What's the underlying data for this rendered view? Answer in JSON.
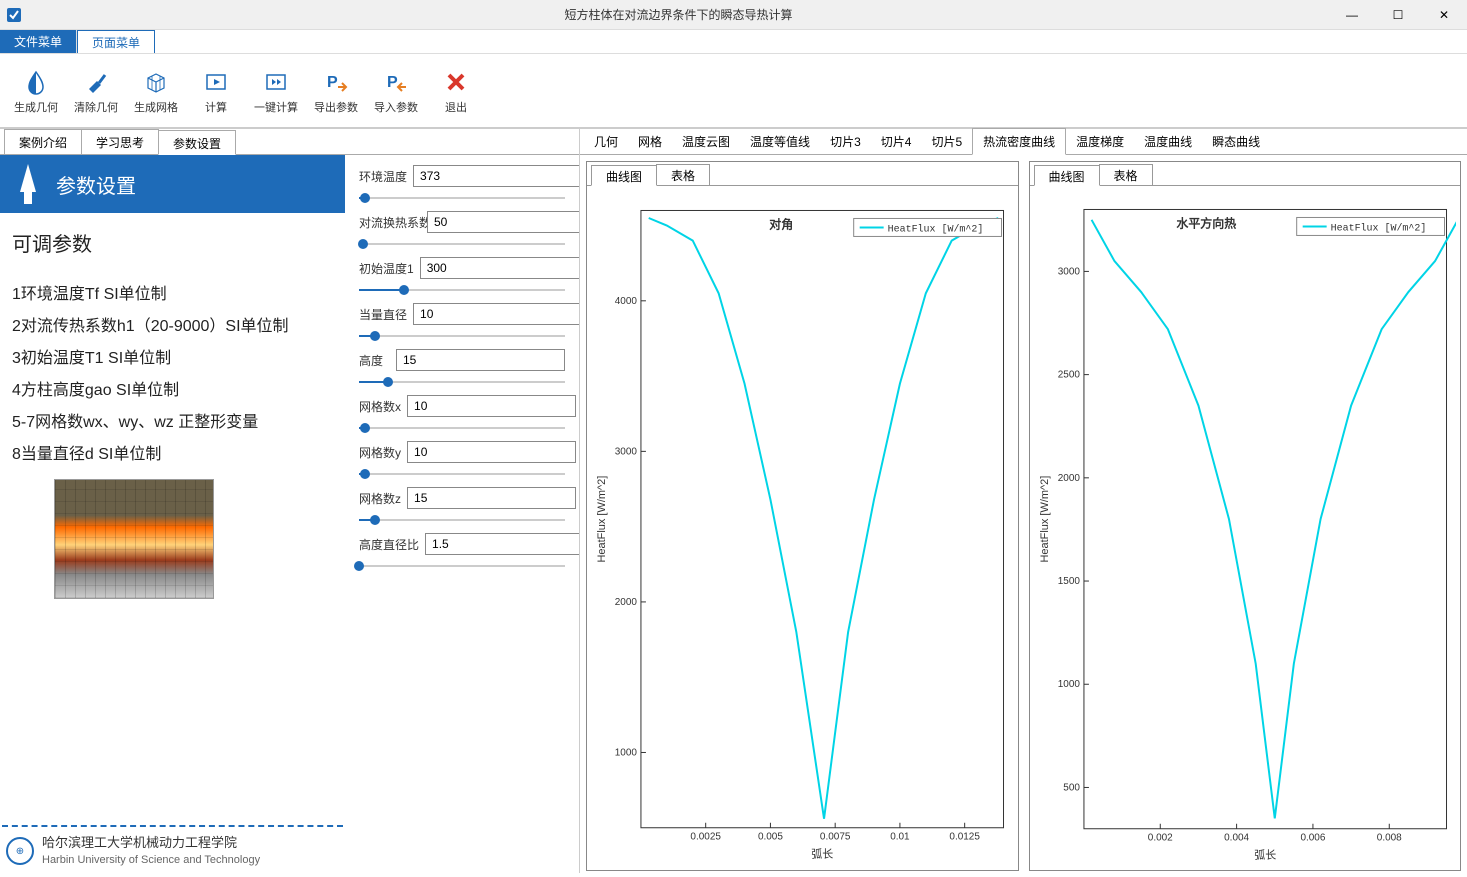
{
  "window": {
    "title": "短方柱体在对流边界条件下的瞬态导热计算"
  },
  "menu": {
    "file": "文件菜单",
    "page": "页面菜单"
  },
  "ribbon": [
    {
      "id": "gen-geom",
      "label": "生成几何"
    },
    {
      "id": "clear-geom",
      "label": "清除几何"
    },
    {
      "id": "gen-mesh",
      "label": "生成网格"
    },
    {
      "id": "compute",
      "label": "计算"
    },
    {
      "id": "oneclick",
      "label": "一键计算"
    },
    {
      "id": "export-params",
      "label": "导出参数"
    },
    {
      "id": "import-params",
      "label": "导入参数"
    },
    {
      "id": "exit",
      "label": "退出"
    }
  ],
  "left_tabs": {
    "intro": "案例介绍",
    "study": "学习思考",
    "params": "参数设置"
  },
  "info": {
    "header": "参数设置",
    "adjustable_title": "可调参数",
    "lines": [
      "1环境温度Tf  SI单位制",
      "2对流传热系数h1（20-9000）SI单位制",
      "3初始温度T1  SI单位制",
      "4方柱高度gao  SI单位制",
      "5-7网格数wx、wy、wz 正整形变量",
      "8当量直径d SI单位制"
    ],
    "univ_cn": "哈尔滨理工大学机械动力工程学院",
    "univ_en": "Harbin University of Science and Technology"
  },
  "params": [
    {
      "key": "env_temp",
      "label": "环境温度",
      "value": "373",
      "fill": 3
    },
    {
      "key": "conv_coef",
      "label": "对流换热系数",
      "value": "50",
      "fill": 2
    },
    {
      "key": "init_temp",
      "label": "初始温度1",
      "value": "300",
      "fill": 22
    },
    {
      "key": "diameter",
      "label": "当量直径",
      "value": "10",
      "fill": 8
    },
    {
      "key": "height",
      "label": "高度",
      "value": "15",
      "fill": 14
    },
    {
      "key": "meshx",
      "label": "网格数x",
      "value": "10",
      "fill": 3
    },
    {
      "key": "meshy",
      "label": "网格数y",
      "value": "10",
      "fill": 3
    },
    {
      "key": "meshz",
      "label": "网格数z",
      "value": "15",
      "fill": 8
    },
    {
      "key": "ratio",
      "label": "高度直径比",
      "value": "1.5",
      "fill": 0
    }
  ],
  "right_tabs": [
    "几何",
    "网格",
    "温度云图",
    "温度等值线",
    "切片3",
    "切片4",
    "切片5",
    "热流密度曲线",
    "温度梯度",
    "温度曲线",
    "瞬态曲线"
  ],
  "right_active": "热流密度曲线",
  "sub_tabs": {
    "curve": "曲线图",
    "table": "表格"
  },
  "axis": {
    "x": "弧长",
    "y": "HeatFlux [W/m^2]"
  },
  "chart_data": [
    {
      "type": "line",
      "title": "对角",
      "xlabel": "弧长",
      "ylabel": "HeatFlux [W/m^2]",
      "legend": "HeatFlux [W/m^2]",
      "xlim": [
        0,
        0.014
      ],
      "ylim": [
        500,
        4600
      ],
      "xticks": [
        0.0025,
        0.005,
        0.0075,
        0.01,
        0.0125
      ],
      "yticks": [
        1000,
        2000,
        3000,
        4000
      ],
      "series": [
        {
          "name": "HeatFlux",
          "color": "#00d4e6",
          "x": [
            0.0003,
            0.001,
            0.002,
            0.003,
            0.004,
            0.005,
            0.006,
            0.00707,
            0.008,
            0.009,
            0.01,
            0.011,
            0.012,
            0.013,
            0.0138
          ],
          "y": [
            4550,
            4500,
            4400,
            4050,
            3450,
            2680,
            1800,
            560,
            1800,
            2680,
            3450,
            4050,
            4400,
            4500,
            4550
          ]
        }
      ]
    },
    {
      "type": "line",
      "title": "水平方向热",
      "xlabel": "弧长",
      "ylabel": "HeatFlux [W/m^2]",
      "legend": "HeatFlux [W/m^2]",
      "xlim": [
        0,
        0.0095
      ],
      "ylim": [
        300,
        3300
      ],
      "xticks": [
        0.002,
        0.004,
        0.006,
        0.008
      ],
      "yticks": [
        500,
        1000,
        1500,
        2000,
        2500,
        3000
      ],
      "series": [
        {
          "name": "HeatFlux",
          "color": "#00d4e6",
          "x": [
            0.0002,
            0.0008,
            0.0015,
            0.0022,
            0.003,
            0.0038,
            0.0045,
            0.005,
            0.0055,
            0.0062,
            0.007,
            0.0078,
            0.0085,
            0.0092,
            0.0098
          ],
          "y": [
            3250,
            3050,
            2900,
            2720,
            2350,
            1800,
            1100,
            350,
            1100,
            1800,
            2350,
            2720,
            2900,
            3050,
            3250
          ]
        }
      ]
    }
  ]
}
